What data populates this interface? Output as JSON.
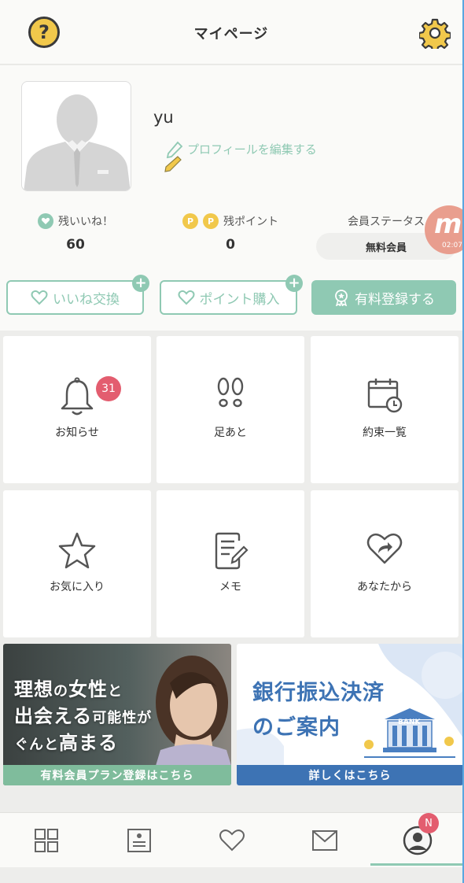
{
  "header": {
    "title": "マイページ"
  },
  "profile": {
    "username": "yu",
    "edit_label": "プロフィールを編集する"
  },
  "stats": {
    "likes_label": "残いいね！",
    "likes_value": "60",
    "points_label": "残ポイント",
    "points_value": "0",
    "status_label": "会員ステータス",
    "status_value": "無料会員"
  },
  "floating_badge": {
    "time": "02:07"
  },
  "actions": {
    "like_exchange": "いいね交換",
    "buy_points": "ポイント購入",
    "paid_register": "有料登録する"
  },
  "menu": [
    {
      "label": "お知らせ",
      "badge": "31",
      "icon": "bell-icon"
    },
    {
      "label": "足あと",
      "icon": "footprints-icon"
    },
    {
      "label": "約束一覧",
      "icon": "calendar-clock-icon"
    },
    {
      "label": "お気に入り",
      "icon": "star-icon"
    },
    {
      "label": "メモ",
      "icon": "memo-icon"
    },
    {
      "label": "あなたから",
      "icon": "heart-share-icon"
    }
  ],
  "banners": {
    "left": {
      "line1_a": "理想",
      "line1_b": "の",
      "line1_c": "女性",
      "line1_d": "と",
      "line2_a": "出会える",
      "line2_b": "可能性が",
      "line3_a": "ぐんと",
      "line3_b": "高まる",
      "footer": "有料会員プラン登録はこちら"
    },
    "right": {
      "line1": "銀行振込決済",
      "line2": "のご案内",
      "bank_sign": "BANK",
      "footer": "詳しくはこちら"
    }
  },
  "bottom_nav": {
    "items": [
      "grid-icon",
      "profile-card-icon",
      "heart-icon",
      "mail-icon",
      "user-icon"
    ],
    "profile_badge": "N"
  },
  "colors": {
    "accent": "#8fc9b3",
    "badge": "#e35d6f",
    "coin": "#f1c84b",
    "bank_blue": "#3d73b4"
  }
}
